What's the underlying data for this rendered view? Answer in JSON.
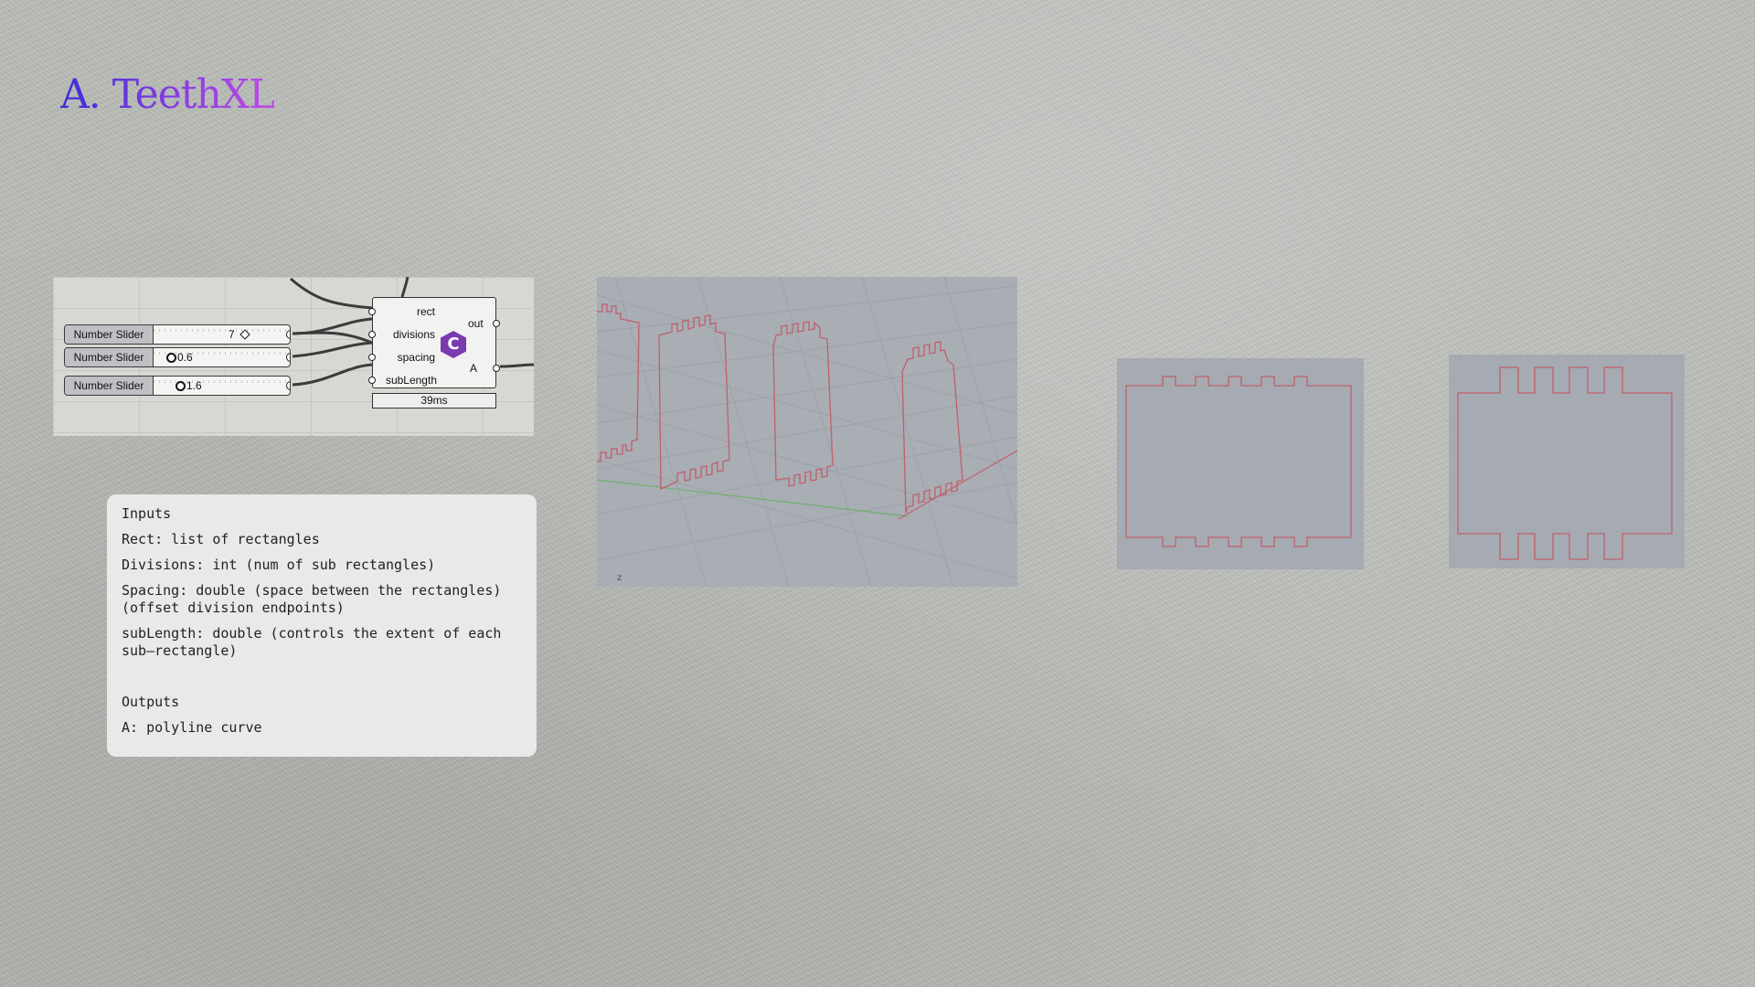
{
  "slide": {
    "title": "A. TeethXL"
  },
  "grasshopper": {
    "sliders": [
      {
        "label": "Number Slider",
        "value": "7",
        "knob": "diamond-icon"
      },
      {
        "label": "Number Slider",
        "value": "0.6",
        "knob": "circle-icon"
      },
      {
        "label": "Number Slider",
        "value": "1.6",
        "knob": "circle-icon"
      }
    ],
    "component": {
      "inputs": [
        "rect",
        "divisions",
        "spacing",
        "subLength"
      ],
      "outputs": [
        "out",
        "A"
      ],
      "icon": "csharp-icon",
      "icon_glyph": "C",
      "timing": "39ms"
    }
  },
  "info": {
    "inputs_heading": "Inputs",
    "rect": "Rect: list of rectangles",
    "divisions": "Divisions: int (num of sub rectangles)",
    "spacing": "Spacing: double (space between the rectangles)\n(offset division endpoints)",
    "sublength": "subLength: double (controls the extent of each\nsub–rectangle)",
    "outputs_heading": "Outputs",
    "a": "A: polyline curve"
  },
  "viewport": {
    "axis_label": "z"
  },
  "colors": {
    "curve": "#c0606a",
    "title_gradient_start": "#3a2fd8",
    "title_gradient_end": "#c04ae8",
    "component_icon": "#7a3ab0"
  }
}
